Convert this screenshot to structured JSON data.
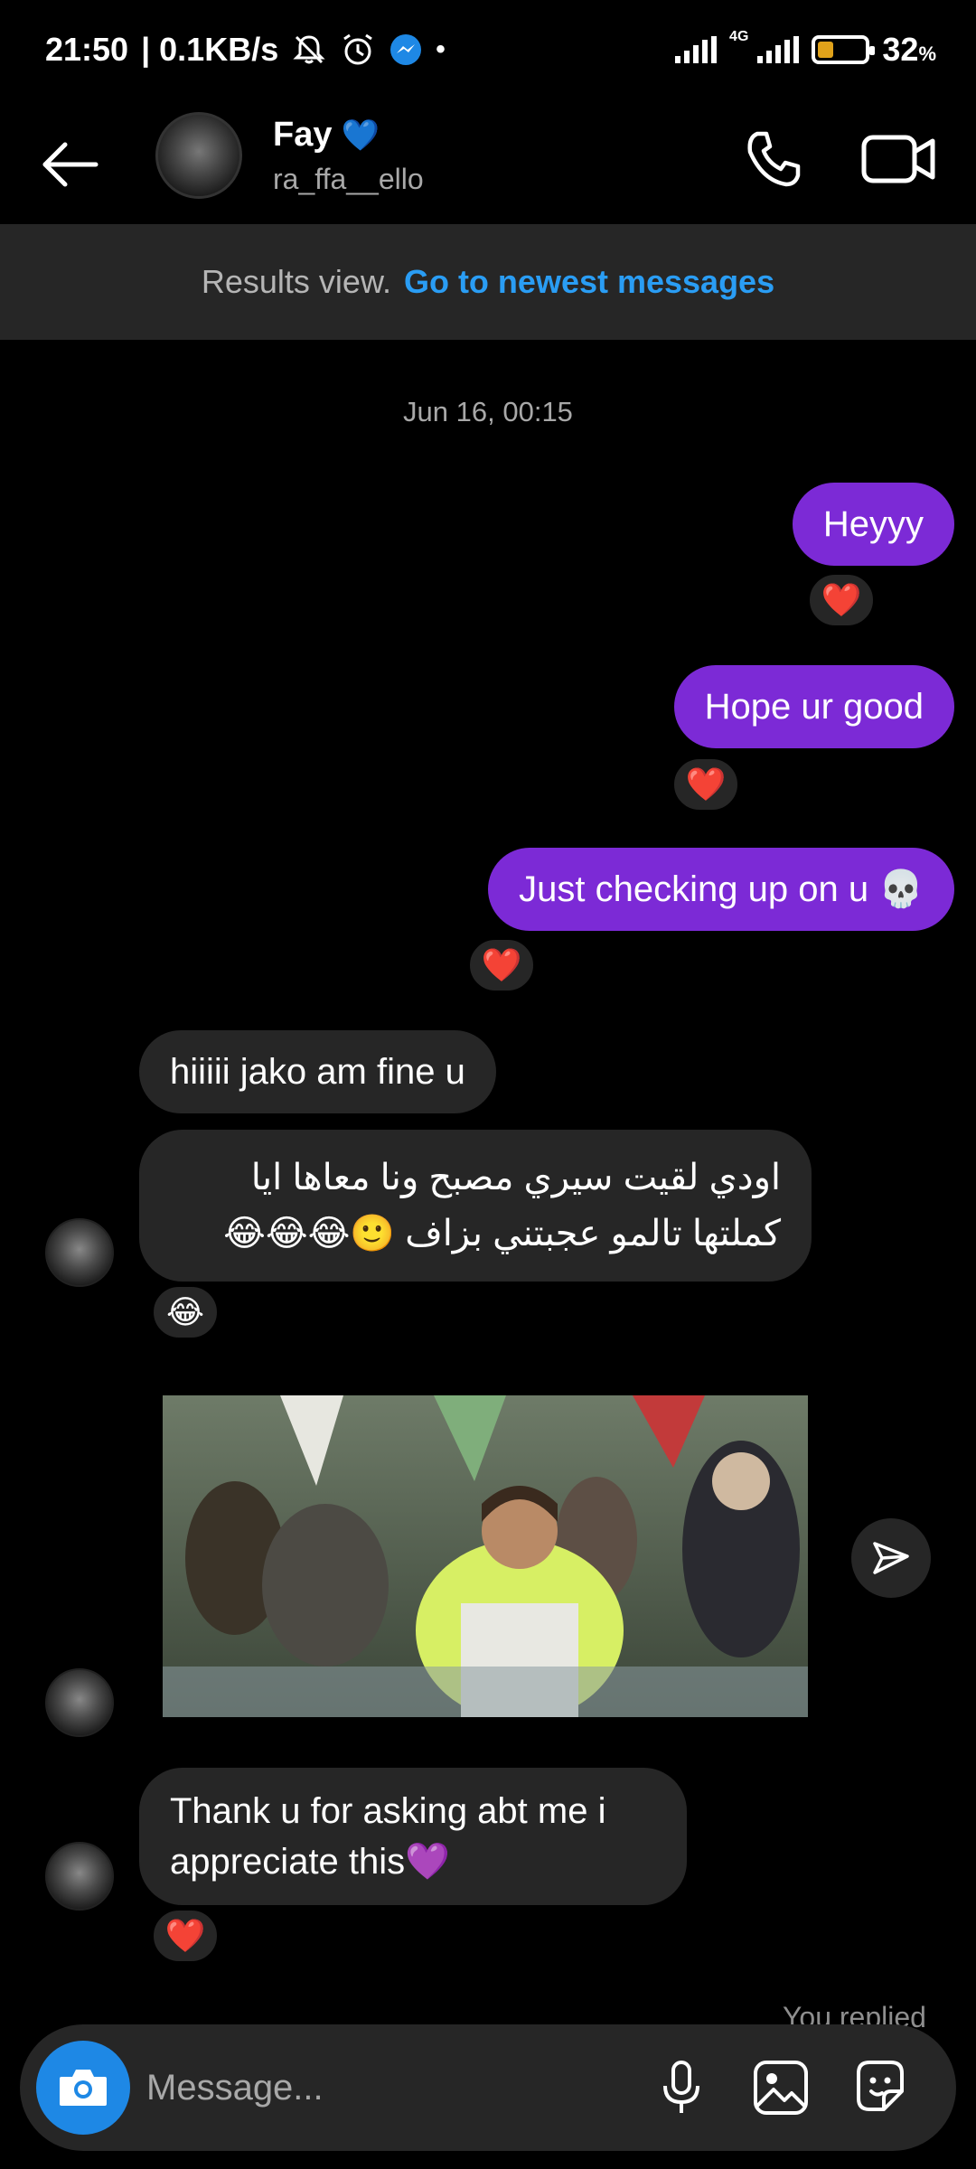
{
  "status_bar": {
    "time": "21:50",
    "net_speed": "| 0.1KB/s",
    "network_label": "4G",
    "battery_text": "32",
    "battery_unit": "%",
    "battery_level": 0.32
  },
  "header": {
    "name": "Fay",
    "badge": "💙",
    "username": "ra_ffa__ello"
  },
  "results_banner": {
    "text": "Results view.",
    "link": "Go to newest messages"
  },
  "timestamp": "Jun 16, 00:15",
  "messages": [
    {
      "text": "Heyyy",
      "reaction": "❤️"
    },
    {
      "text": "Hope ur good",
      "reaction": "❤️"
    },
    {
      "text": "Just checking up on u 💀",
      "reaction": "❤️"
    },
    {
      "text": "hiiiii jako am fine u"
    },
    {
      "text": "اودي لقيت سيري مصبح ونا معاها ايا كملتها تالمو عجبتني بزاف 🙂😂😂😂",
      "reaction": "😂"
    },
    {
      "text": "Thank u for asking abt me i appreciate this💜",
      "reaction": "❤️"
    }
  ],
  "you_replied": "You replied",
  "composer": {
    "placeholder": "Message..."
  },
  "colors": {
    "outgoing_bubble": "#7c2ad6",
    "incoming_bubble": "#262626",
    "link": "#2a9df4",
    "camera_button": "#1e88e5"
  }
}
